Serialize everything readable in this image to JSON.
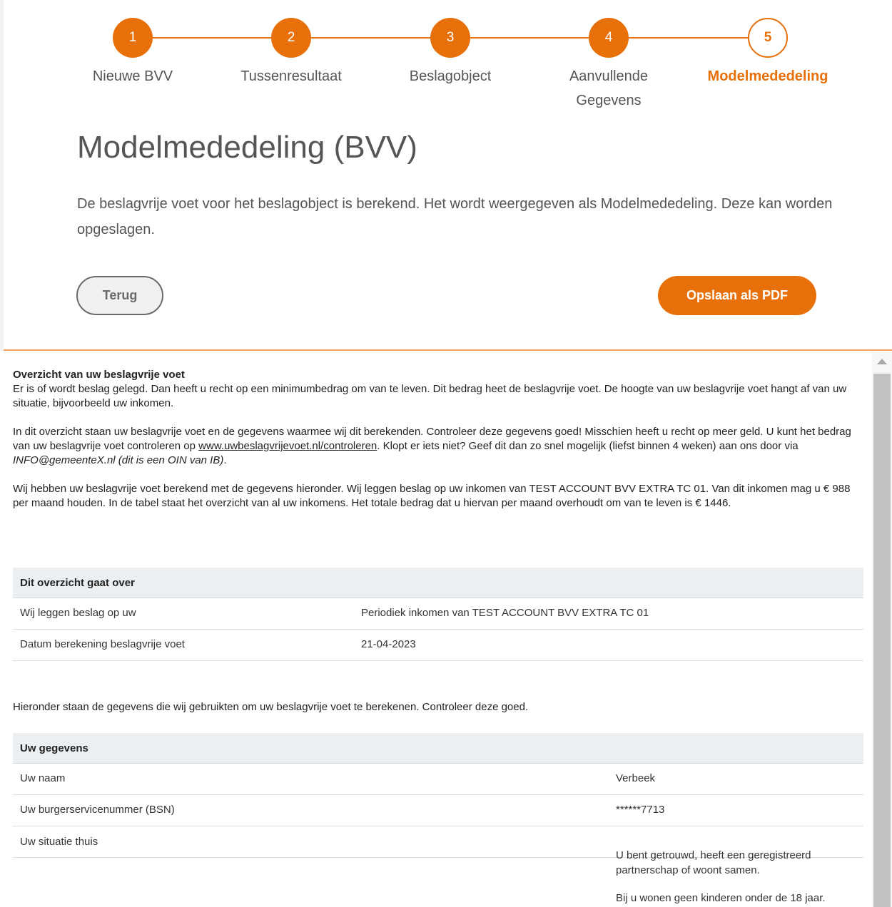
{
  "stepper": {
    "steps": [
      {
        "number": "1",
        "label": "Nieuwe BVV"
      },
      {
        "number": "2",
        "label": "Tussenresultaat"
      },
      {
        "number": "3",
        "label": "Beslagobject"
      },
      {
        "number": "4",
        "label_line1": "Aanvullende",
        "label_line2": "Gegevens"
      },
      {
        "number": "5",
        "label": "Modelmededeling"
      }
    ],
    "current_step": "5"
  },
  "page": {
    "title": "Modelmededeling (BVV)",
    "intro": "De beslagvrije voet voor het beslagobject is berekend. Het wordt weergegeven als Modelmededeling. Deze kan worden opgeslagen."
  },
  "buttons": {
    "back": "Terug",
    "save_pdf": "Opslaan als PDF"
  },
  "document": {
    "heading": "Overzicht van uw beslagvrije voet",
    "para1": "Er is of wordt beslag gelegd. Dan heeft u recht op een minimumbedrag om van te leven. Dit bedrag heet de beslagvrije voet. De hoogte van uw beslagvrije voet hangt af van uw situatie, bijvoorbeeld uw inkomen.",
    "para2_a": "In dit overzicht staan uw beslagvrije voet en de gegevens waarmee wij dit berekenden. Controleer deze gegevens goed! Misschien heeft u recht op meer geld. U kunt het bedrag van uw beslagvrije voet controleren op ",
    "para2_link": "www.uwbeslagvrijevoet.nl/controleren",
    "para2_b": ". Klopt er iets niet? Geef dit dan zo snel mogelijk (liefst binnen 4 weken) aan ons door via ",
    "para2_em": "INFO@gemeenteX.nl (dit is een OIN van IB)",
    "para2_c": ".",
    "para3": "Wij hebben uw beslagvrije voet berekend met de gegevens hieronder. Wij leggen beslag op uw inkomen van TEST ACCOUNT BVV EXTRA TC 01. Van dit inkomen mag u € 988 per maand houden. In de tabel staat het overzicht van al uw inkomens. Het totale bedrag dat u hiervan per maand overhoudt om van te leven is € 1446.",
    "overview_table": {
      "header": "Dit overzicht gaat over",
      "rows": [
        {
          "key": "Wij leggen beslag op uw",
          "value": "Periodiek inkomen van TEST ACCOUNT BVV EXTRA TC 01"
        },
        {
          "key": "Datum berekening beslagvrije voet",
          "value": "21-04-2023"
        }
      ]
    },
    "middle_text": "Hieronder staan de gegevens die wij gebruikten om uw beslagvrije voet te berekenen. Controleer deze goed.",
    "details_table": {
      "header": "Uw gegevens",
      "rows": [
        {
          "key": "Uw naam",
          "value": "Verbeek"
        },
        {
          "key": "Uw burgerservicenummer (BSN)",
          "value": "******7713"
        }
      ],
      "situation_key": "Uw situatie thuis",
      "situation_line1": "U bent getrouwd, heeft een geregistreerd partnerschap of woont samen.",
      "situation_line2": "Bij u wonen geen kinderen onder de 18 jaar."
    }
  },
  "colors": {
    "accent": "#e8700a",
    "table_header_bg": "#eceff2"
  }
}
